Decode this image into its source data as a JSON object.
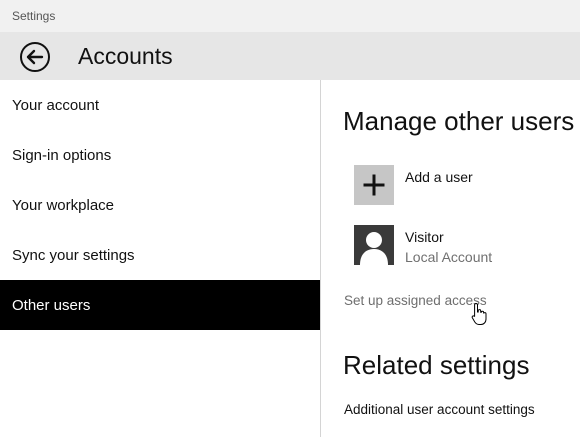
{
  "window": {
    "title": "Settings"
  },
  "header": {
    "title": "Accounts",
    "back_icon": "back-arrow-circle-icon"
  },
  "sidebar": {
    "items": [
      {
        "label": "Your account",
        "active": false
      },
      {
        "label": "Sign-in options",
        "active": false
      },
      {
        "label": "Your workplace",
        "active": false
      },
      {
        "label": "Sync your settings",
        "active": false
      },
      {
        "label": "Other users",
        "active": true
      }
    ]
  },
  "main": {
    "manage_title": "Manage other users",
    "add_user": {
      "label": "Add a user",
      "icon": "plus-icon"
    },
    "users": [
      {
        "name": "Visitor",
        "type": "Local Account",
        "icon": "person-silhouette-icon"
      }
    ],
    "assigned_access_link": "Set up assigned access",
    "related_title": "Related settings",
    "related_link": "Additional user account settings"
  },
  "colors": {
    "active_nav_bg": "#000000",
    "header_bg": "#e6e6e6",
    "add_tile_bg": "#c6c6c6",
    "avatar_bg": "#3a3a3a"
  }
}
